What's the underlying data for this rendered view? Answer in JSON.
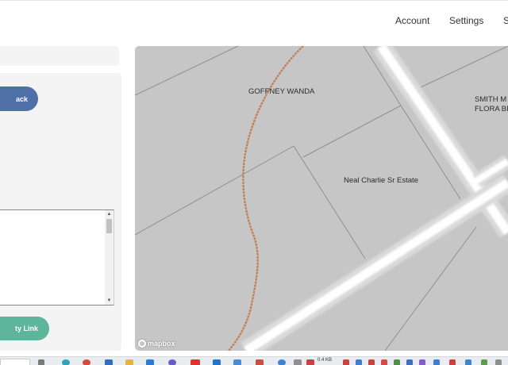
{
  "nav": {
    "account": "Account",
    "settings": "Settings",
    "third_partial": "S"
  },
  "left_panel": {
    "primary_button_label": "ack",
    "secondary_button_label": "ty Link",
    "textarea_value": ""
  },
  "map": {
    "labels": {
      "goffney": "GOFFNEY WANDA",
      "neal": "Neal Charlie Sr Estate",
      "smith_line1": "SMITH M",
      "smith_line2": "FLORA BR"
    },
    "attribution": "mapbox",
    "colors": {
      "background": "#c6c6c6",
      "road": "#ffffff",
      "creek": "#c2805a",
      "parcel_line": "#8a8a8a"
    }
  },
  "taskbar": {
    "partial_text": "0.4 KB"
  }
}
